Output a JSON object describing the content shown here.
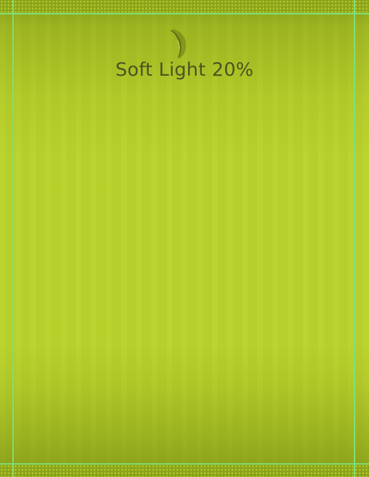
{
  "title": "Soft Light 20%",
  "logo_icon": "leaf-feather-icon",
  "colors": {
    "background": "#bcd42e",
    "title": "#4d5322",
    "guides": "#7de07a"
  }
}
